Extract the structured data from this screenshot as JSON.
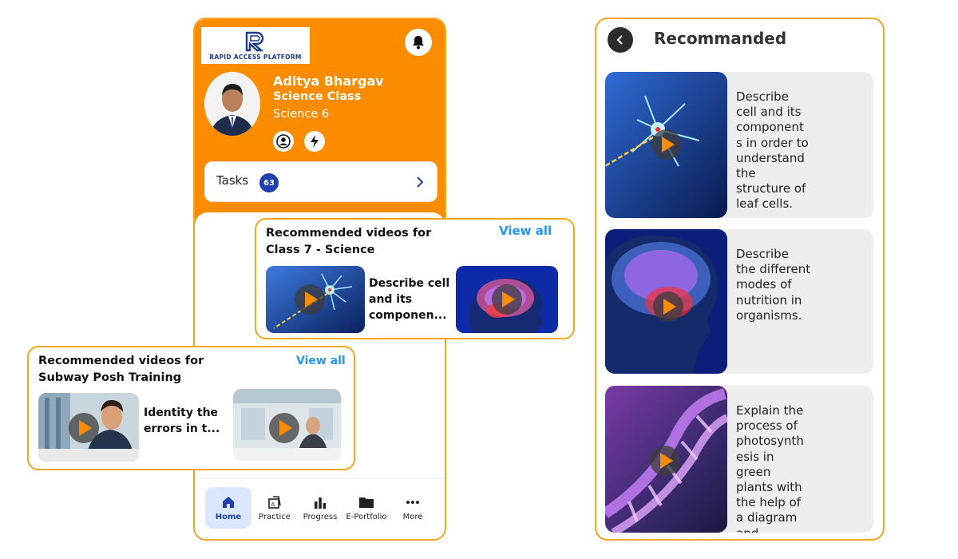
{
  "brand": {
    "logo_text": "RAPID ACCESS PLATFORM"
  },
  "profile": {
    "name": "Aditya Bhargav",
    "class": "Science Class",
    "subject": "Science 6"
  },
  "tasks": {
    "label": "Tasks",
    "count": "63"
  },
  "bottom_nav": [
    {
      "label": "Home",
      "icon": "home-icon",
      "active": true
    },
    {
      "label": "Practice",
      "icon": "practice-icon",
      "active": false
    },
    {
      "label": "Progress",
      "icon": "bar-chart-icon",
      "active": false
    },
    {
      "label": "E-Portfolio",
      "icon": "folder-icon",
      "active": false
    },
    {
      "label": "More",
      "icon": "more-icon",
      "active": false
    }
  ],
  "rec_science": {
    "title_line1": "Recommended videos for",
    "title_line2": "Class 7 - Science",
    "view_all": "View all",
    "caption_line1": "Describe cell",
    "caption_line2": "and its",
    "caption_line3": "componen..."
  },
  "rec_posh": {
    "title_line1": "Recommended videos for",
    "title_line2": "Subway Posh Training",
    "view_all": "View all",
    "caption_line1": "Identity the",
    "caption_line2": "errors in t..."
  },
  "panel": {
    "title": "Recommanded",
    "items": [
      {
        "lines": [
          "Describe",
          "cell and its",
          "component",
          "s in order to",
          "understand",
          "the",
          "structure of",
          "leaf cells."
        ]
      },
      {
        "lines": [
          "Describe",
          "the different",
          "modes of",
          "nutrition in",
          "organisms."
        ]
      },
      {
        "lines": [
          "Explain the",
          "process of",
          "photosynth",
          "esis in",
          "green",
          "plants with",
          "the help of",
          "a diagram",
          "and"
        ]
      }
    ]
  },
  "colors": {
    "accent": "#fb8c00",
    "link": "#2196f3",
    "border": "#f5a524",
    "badge": "#1e40af"
  }
}
